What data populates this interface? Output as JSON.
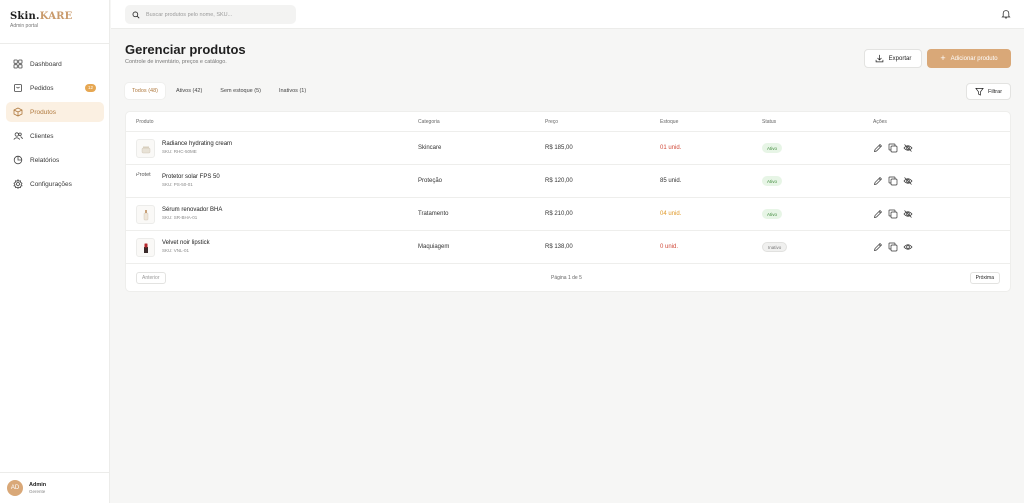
{
  "brand": {
    "name_main": "Skin.",
    "name_accent": "KARE",
    "subtitle": "Admin portal"
  },
  "colors": {
    "accent": "#d9a878",
    "accent_dark": "#b07a3f",
    "active_bg": "#fbf0e2",
    "danger": "#d04a3a",
    "warning": "#e09a2a",
    "success": "#3f8a3c"
  },
  "sidebar": {
    "items": [
      {
        "label": "Dashboard",
        "icon": "dashboard-icon"
      },
      {
        "label": "Pedidos",
        "icon": "orders-icon",
        "badge": "12"
      },
      {
        "label": "Produtos",
        "icon": "box-icon",
        "active": true
      },
      {
        "label": "Clientes",
        "icon": "users-icon"
      },
      {
        "label": "Relatórios",
        "icon": "chart-icon"
      },
      {
        "label": "Configurações",
        "icon": "gear-icon"
      }
    ],
    "user": {
      "initials": "AD",
      "name": "Admin",
      "role": "Gerente"
    }
  },
  "topbar": {
    "search_placeholder": "Buscar produtos pelo nome, SKU..."
  },
  "main": {
    "title": "Gerenciar produtos",
    "subtitle": "Controle de inventário, preços e catálogo.",
    "export_label": "Exportar",
    "add_label": "Adicionar produto",
    "filter_label": "Filtrar",
    "tabs": [
      {
        "label": "Todos (48)",
        "active": true
      },
      {
        "label": "Ativos (42)"
      },
      {
        "label": "Sem estoque (5)"
      },
      {
        "label": "Inativos (1)"
      }
    ]
  },
  "table": {
    "headers": {
      "product": "Produto",
      "category": "Categoria",
      "price": "Preço",
      "stock": "Estoque",
      "status": "Status",
      "actions": "Ações"
    },
    "rows": [
      {
        "name": "Radiance hydrating cream",
        "sku": "SKU: RHC-50ME",
        "category": "Skincare",
        "price": "R$ 185,00",
        "stock": "01 unid.",
        "stock_level": "low",
        "status": "Ativo",
        "thumb_alt": ""
      },
      {
        "name": "Protetor solar FPS 50",
        "sku": "SKU: PS-50-01",
        "category": "Proteção",
        "price": "R$ 120,00",
        "stock": "85 unid.",
        "stock_level": "ok",
        "status": "Ativo",
        "thumb_alt": "Protet"
      },
      {
        "name": "Sérum renovador BHA",
        "sku": "SKU: SR-BHA-01",
        "category": "Tratamento",
        "price": "R$ 210,00",
        "stock": "04 unid.",
        "stock_level": "warn",
        "status": "Ativo",
        "thumb_alt": ""
      },
      {
        "name": "Velvet noir lipstick",
        "sku": "SKU: VNL-01",
        "category": "Maquiagem",
        "price": "R$ 138,00",
        "stock": "0 unid.",
        "stock_level": "low",
        "status": "Inativo",
        "thumb_alt": ""
      }
    ],
    "pagination": {
      "prev": "Anterior",
      "info": "Página 1 de 5",
      "next": "Próxima"
    }
  }
}
